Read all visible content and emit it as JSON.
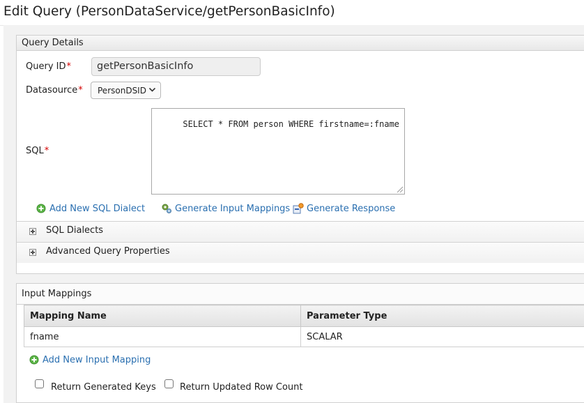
{
  "page": {
    "title": "Edit Query (PersonDataService/getPersonBasicInfo)"
  },
  "query_details": {
    "section_title": "Query Details",
    "query_id": {
      "label": "Query ID",
      "required_mark": "*",
      "value": "getPersonBasicInfo"
    },
    "datasource": {
      "label": "Datasource",
      "required_mark": "*",
      "selected": "PersonDSID"
    },
    "sql": {
      "label": "SQL",
      "required_mark": "*",
      "value": "SELECT * FROM person WHERE firstname=:fname"
    },
    "actions": {
      "add_dialect": "Add New SQL Dialect",
      "generate_mappings": "Generate Input Mappings",
      "generate_response": "Generate Response"
    },
    "collapsibles": {
      "sql_dialects": "SQL Dialects",
      "advanced": "Advanced Query Properties"
    }
  },
  "input_mappings": {
    "section_title": "Input Mappings",
    "columns": [
      "Mapping Name",
      "Parameter Type"
    ],
    "rows": [
      {
        "name": "fname",
        "type": "SCALAR"
      }
    ],
    "add_label": "Add New Input Mapping",
    "checkboxes": {
      "return_generated_keys": {
        "label": "Return Generated Keys",
        "checked": false
      },
      "return_updated_row_count": {
        "label": "Return Updated Row Count",
        "checked": false
      }
    }
  },
  "colors": {
    "link": "#2a6fb0",
    "required": "#d40000",
    "panel_border": "#cfcfcf"
  },
  "icons": [
    "add-circle-icon",
    "gears-icon",
    "generate-response-icon",
    "expand-plus-icon",
    "chevron-down-icon"
  ]
}
